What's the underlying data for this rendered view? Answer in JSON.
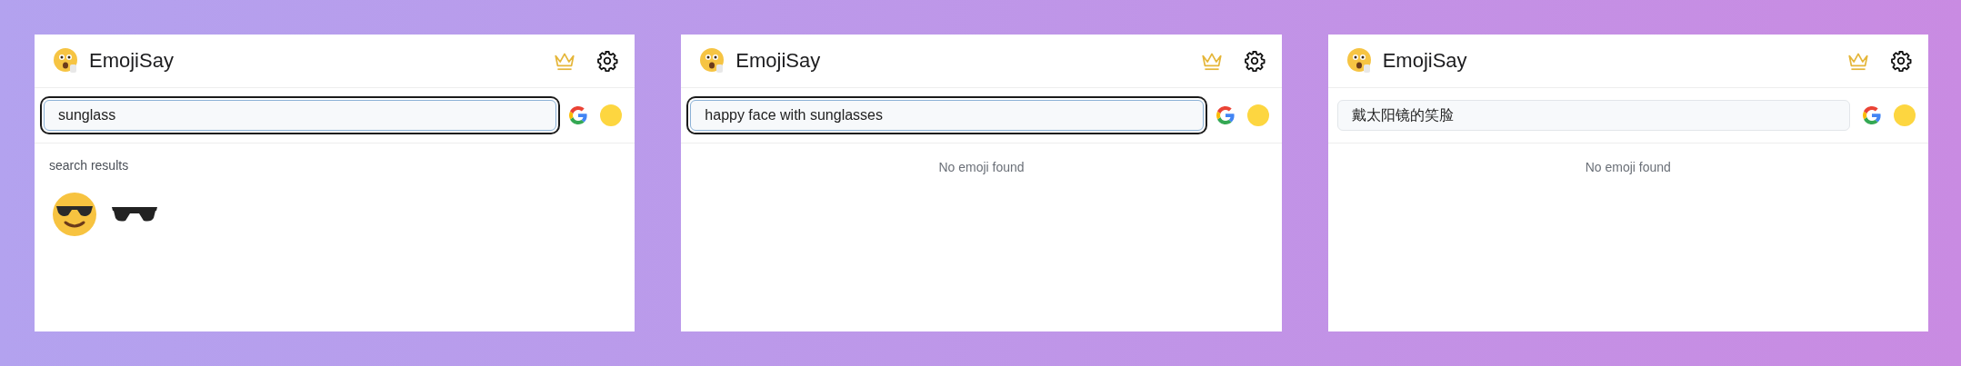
{
  "panels": [
    {
      "title": "EmojiSay",
      "query": "sunglass",
      "focused": true,
      "results_heading": "search results",
      "results": [
        {
          "kind": "cool-face"
        },
        {
          "kind": "sunglasses"
        }
      ]
    },
    {
      "title": "EmojiSay",
      "query": "happy face with sunglasses",
      "focused": true,
      "message": "No emoji found"
    },
    {
      "title": "EmojiSay",
      "query": "戴太阳镜的笑脸",
      "focused": false,
      "message": "No emoji found"
    }
  ]
}
